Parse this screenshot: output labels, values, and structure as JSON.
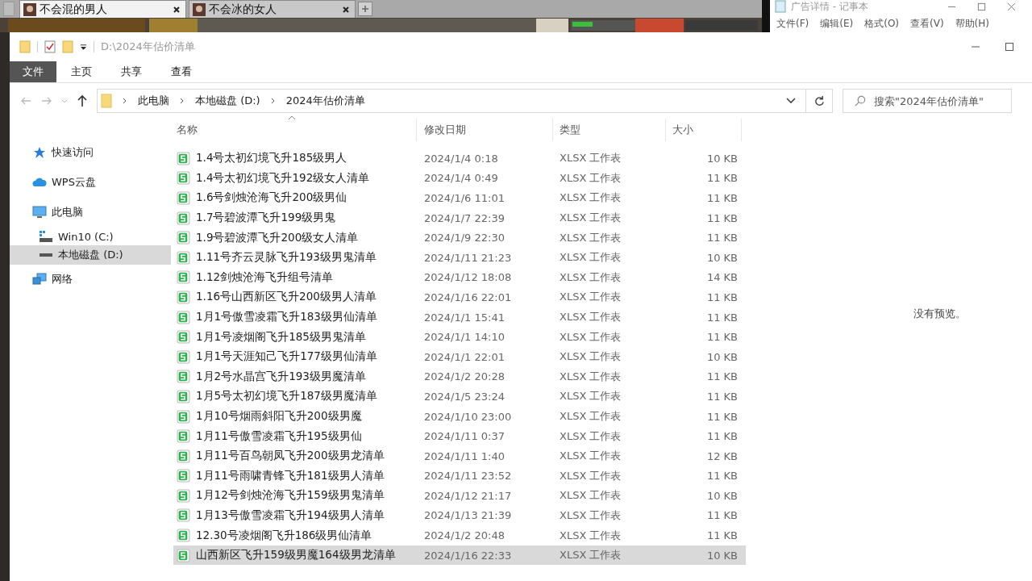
{
  "browser_tabs": [
    {
      "label": "不会混的男人",
      "selected": true
    },
    {
      "label": "不会冰的女人",
      "selected": false
    }
  ],
  "notepad": {
    "title": "广告详情 - 记事本",
    "menu": [
      "文件(F)",
      "编辑(E)",
      "格式(O)",
      "查看(V)",
      "帮助(H)"
    ]
  },
  "window": {
    "title": "D:\\2024年估价清单"
  },
  "ribbon_tabs": [
    {
      "label": "文件",
      "selected": true
    },
    {
      "label": "主页",
      "selected": false
    },
    {
      "label": "共享",
      "selected": false
    },
    {
      "label": "查看",
      "selected": false
    }
  ],
  "breadcrumb": [
    "此电脑",
    "本地磁盘 (D:)",
    "2024年估价清单"
  ],
  "search": {
    "placeholder": "搜索\"2024年估价清单\""
  },
  "sidebar": {
    "items": [
      {
        "label": "快速访问",
        "selected": false
      },
      {
        "label": "WPS云盘",
        "selected": false
      },
      {
        "label": "此电脑",
        "selected": false,
        "children": [
          {
            "label": "Win10 (C:)",
            "selected": false
          },
          {
            "label": "本地磁盘 (D:)",
            "selected": true
          }
        ]
      },
      {
        "label": "网络",
        "selected": false
      }
    ]
  },
  "table": {
    "columns": [
      "名称",
      "修改日期",
      "类型",
      "大小"
    ],
    "rows": [
      {
        "name": "1.4号太初幻境飞升185级男人",
        "date": "2024/1/4 0:18",
        "type": "XLSX 工作表",
        "size": "10 KB",
        "selected": false
      },
      {
        "name": "1.4号太初幻境飞升192级女人清单",
        "date": "2024/1/4 0:49",
        "type": "XLSX 工作表",
        "size": "11 KB",
        "selected": false
      },
      {
        "name": "1.6号剑烛沧海飞升200级男仙",
        "date": "2024/1/6 11:01",
        "type": "XLSX 工作表",
        "size": "11 KB",
        "selected": false
      },
      {
        "name": "1.7号碧波潭飞升199级男鬼",
        "date": "2024/1/7 22:39",
        "type": "XLSX 工作表",
        "size": "11 KB",
        "selected": false
      },
      {
        "name": "1.9号碧波潭飞升200级女人清单",
        "date": "2024/1/9 22:30",
        "type": "XLSX 工作表",
        "size": "11 KB",
        "selected": false
      },
      {
        "name": "1.11号齐云灵脉飞升193级男鬼清单",
        "date": "2024/1/11 21:23",
        "type": "XLSX 工作表",
        "size": "10 KB",
        "selected": false
      },
      {
        "name": "1.12剑烛沧海飞升组号清单",
        "date": "2024/1/12 18:08",
        "type": "XLSX 工作表",
        "size": "14 KB",
        "selected": false
      },
      {
        "name": "1.16号山西新区飞升200级男人清单",
        "date": "2024/1/16 22:01",
        "type": "XLSX 工作表",
        "size": "11 KB",
        "selected": false
      },
      {
        "name": "1月1号傲雪凌霜飞升183级男仙清单",
        "date": "2024/1/1 15:41",
        "type": "XLSX 工作表",
        "size": "11 KB",
        "selected": false
      },
      {
        "name": "1月1号凌烟阁飞升185级男鬼清单",
        "date": "2024/1/1 14:10",
        "type": "XLSX 工作表",
        "size": "11 KB",
        "selected": false
      },
      {
        "name": "1月1号天涯知己飞升177级男仙清单",
        "date": "2024/1/1 22:01",
        "type": "XLSX 工作表",
        "size": "10 KB",
        "selected": false
      },
      {
        "name": "1月2号水晶宫飞升193级男魔清单",
        "date": "2024/1/2 20:28",
        "type": "XLSX 工作表",
        "size": "11 KB",
        "selected": false
      },
      {
        "name": "1月5号太初幻境飞升187级男魔清单",
        "date": "2024/1/5 23:24",
        "type": "XLSX 工作表",
        "size": "11 KB",
        "selected": false
      },
      {
        "name": "1月10号烟雨斜阳飞升200级男魔",
        "date": "2024/1/10 23:00",
        "type": "XLSX 工作表",
        "size": "11 KB",
        "selected": false
      },
      {
        "name": "1月11号傲雪凌霜飞升195级男仙",
        "date": "2024/1/11 0:37",
        "type": "XLSX 工作表",
        "size": "11 KB",
        "selected": false
      },
      {
        "name": "1月11号百鸟朝凤飞升200级男龙清单",
        "date": "2024/1/11 1:40",
        "type": "XLSX 工作表",
        "size": "12 KB",
        "selected": false
      },
      {
        "name": "1月11号雨啸青锋飞升181级男人清单",
        "date": "2024/1/11 23:52",
        "type": "XLSX 工作表",
        "size": "11 KB",
        "selected": false
      },
      {
        "name": "1月12号剑烛沧海飞升159级男鬼清单",
        "date": "2024/1/12 21:17",
        "type": "XLSX 工作表",
        "size": "10 KB",
        "selected": false
      },
      {
        "name": "1月13号傲雪凌霜飞升194级男人清单",
        "date": "2024/1/13 21:39",
        "type": "XLSX 工作表",
        "size": "11 KB",
        "selected": false
      },
      {
        "name": "12.30号凌烟阁飞升186级男仙清单",
        "date": "2024/1/2 20:48",
        "type": "XLSX 工作表",
        "size": "11 KB",
        "selected": false
      },
      {
        "name": "山西新区飞升159级男魔164级男龙清单",
        "date": "2024/1/16 22:33",
        "type": "XLSX 工作表",
        "size": "10 KB",
        "selected": true
      }
    ]
  },
  "preview": {
    "message": "没有预览。"
  }
}
